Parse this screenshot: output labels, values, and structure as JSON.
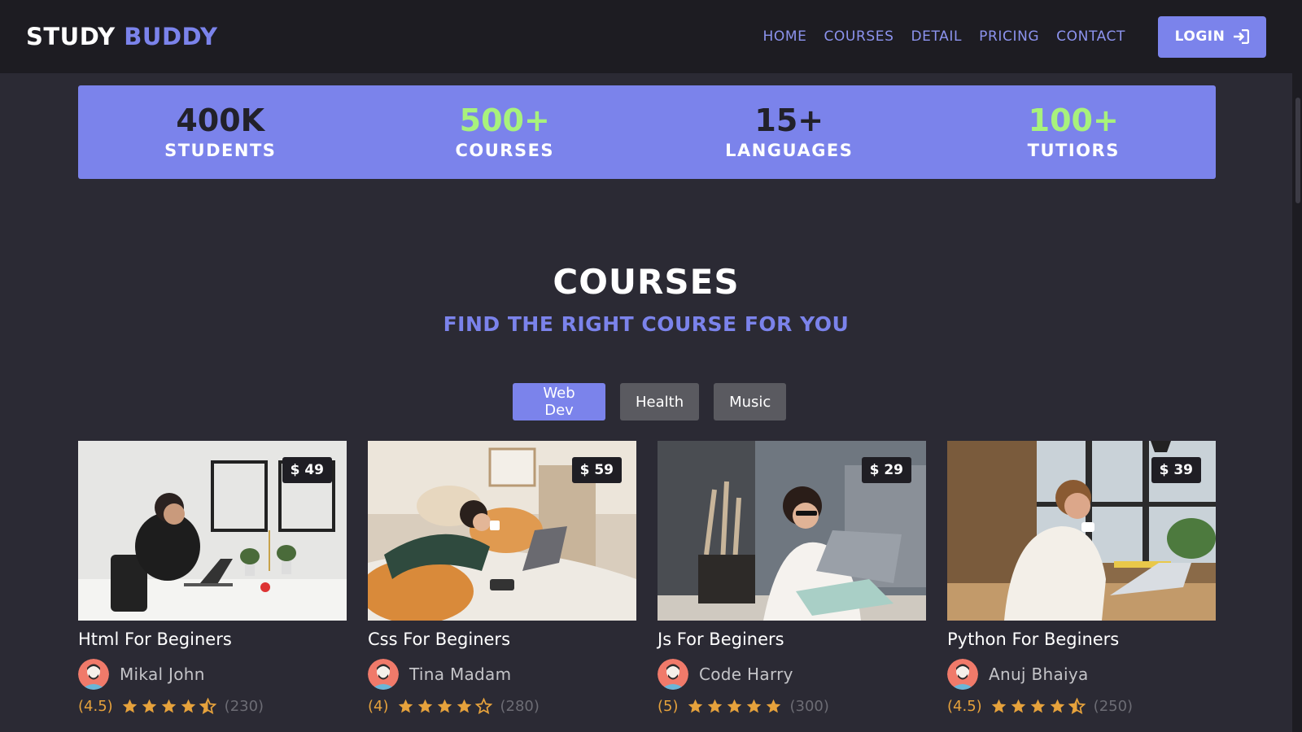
{
  "brand": {
    "part1": "STUDY",
    "part2": "BUDDY"
  },
  "nav": {
    "links": [
      "HOME",
      "COURSES",
      "DETAIL",
      "PRICING",
      "CONTACT"
    ],
    "login_label": "LOGIN"
  },
  "stats": [
    {
      "number": "400K",
      "label": "STUDENTS"
    },
    {
      "number": "500+",
      "label": "COURSES"
    },
    {
      "number": "15+",
      "label": "LANGUAGES"
    },
    {
      "number": "100+",
      "label": "TUTIORS"
    }
  ],
  "section": {
    "title": "COURSES",
    "subtitle": "FIND THE RIGHT COURSE FOR YOU"
  },
  "filters": [
    {
      "label": "Web Dev",
      "active": true
    },
    {
      "label": "Health",
      "active": false
    },
    {
      "label": "Music",
      "active": false
    }
  ],
  "courses": [
    {
      "price": "$ 49",
      "title": "Html For Beginers",
      "author": "Mikal John",
      "rating": "(4.5)",
      "stars": 4.5,
      "count": "(230)"
    },
    {
      "price": "$ 59",
      "title": "Css For Beginers",
      "author": "Tina Madam",
      "rating": "(4)",
      "stars": 4,
      "count": "(280)"
    },
    {
      "price": "$ 29",
      "title": "Js For Beginers",
      "author": "Code Harry",
      "rating": "(5)",
      "stars": 5,
      "count": "(300)"
    },
    {
      "price": "$ 39",
      "title": "Python For Beginers",
      "author": "Anuj Bhaiya",
      "rating": "(4.5)",
      "stars": 4.5,
      "count": "(250)"
    }
  ],
  "colors": {
    "accent": "#7b83eb",
    "background": "#2b2a34",
    "navbar": "#1d1c22",
    "star": "#e6a23c",
    "stat_highlight": "#a8f27c"
  }
}
